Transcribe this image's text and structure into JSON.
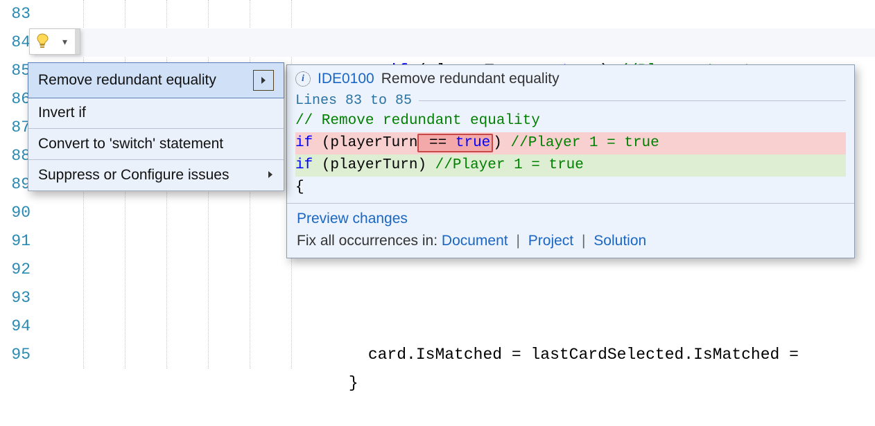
{
  "gutter": {
    "start": 83,
    "end": 95
  },
  "code": {
    "line83": {
      "text": "// Remove redundant equality"
    },
    "line84": {
      "kw_if": "if",
      "open": " (playerTurn == ",
      "bool": "true",
      "close": ") ",
      "cmnt": "//Player 1 = true"
    },
    "line93": {
      "text": "card.IsMatched = lastCardSelected.IsMatched ="
    },
    "line94": {
      "text": "}"
    }
  },
  "bulb": {
    "name": "lightbulb-icon",
    "chev": "▾"
  },
  "menu": {
    "items": [
      {
        "label": "Remove redundant equality",
        "selected": true,
        "submenu": true
      },
      {
        "label": "Invert if",
        "selected": false,
        "submenu": false
      },
      {
        "label": "Convert to 'switch' statement",
        "selected": false,
        "submenu": false
      },
      {
        "label": "Suppress or Configure issues",
        "selected": false,
        "submenu": true
      }
    ]
  },
  "preview": {
    "header": {
      "code_id": "IDE0100",
      "description": "Remove redundant equality"
    },
    "range_label": "Lines 83 to 85",
    "diff": {
      "context1": {
        "cmnt": "// Remove redundant equality"
      },
      "removed": {
        "kw_if": "if",
        "pre": " (playerTurn",
        "err_eq": " == ",
        "err_true": "true",
        "post": ") ",
        "cmnt": "//Player 1 = true"
      },
      "added": {
        "kw_if": "if",
        "body": " (playerTurn) ",
        "cmnt": "//Player 1 = true"
      },
      "context2": "{"
    },
    "footer": {
      "preview_changes": "Preview changes",
      "fix_all_prefix": "Fix all occurrences in: ",
      "links": {
        "document": "Document",
        "project": "Project",
        "solution": "Solution"
      },
      "sep": "|"
    }
  }
}
